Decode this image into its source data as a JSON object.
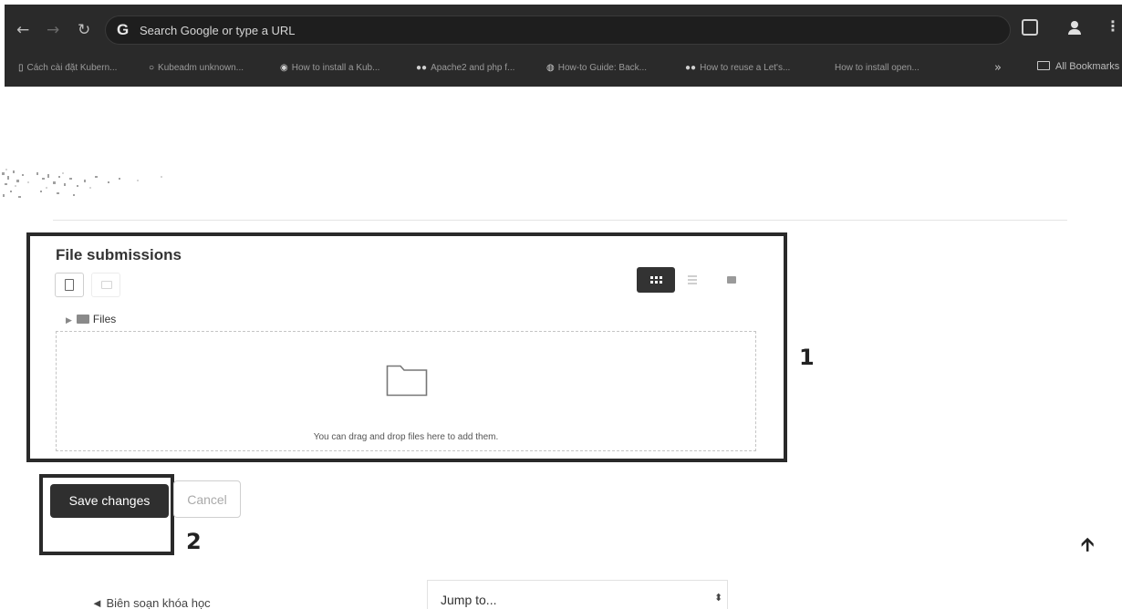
{
  "browser": {
    "omnibox": {
      "placeholder": "Search Google or type a URL",
      "logo": "G"
    },
    "bookmarks": [
      {
        "label": "Cách cài đặt Kubern..."
      },
      {
        "label": "Kubeadm unknown..."
      },
      {
        "label": "How to install a Kub..."
      },
      {
        "label": "Apache2 and php f..."
      },
      {
        "label": "How-to Guide: Back..."
      },
      {
        "label": "How to reuse a Let's..."
      },
      {
        "label": "How to install open..."
      }
    ],
    "more_label": "»",
    "all_bookmarks_label": "All Bookmarks"
  },
  "file_manager": {
    "title": "File submissions",
    "path_label": "Files",
    "dropzone_text": "You can drag and drop files here to add them."
  },
  "annotations": {
    "box1_label": "1",
    "box2_label": "2"
  },
  "form": {
    "save_label": "Save changes",
    "cancel_label": "Cancel"
  },
  "footer": {
    "prev_link": "◄ Biên soạn khóa học",
    "jump_placeholder": "Jump to...",
    "jump_caret": "⬍"
  },
  "icons": {
    "back": "back-arrow-icon",
    "forward": "forward-arrow-icon",
    "reload": "reload-icon",
    "extensions": "extensions-icon",
    "profile": "profile-icon",
    "menu": "kebab-menu-icon",
    "scroll_top": "arrow-up-icon"
  }
}
